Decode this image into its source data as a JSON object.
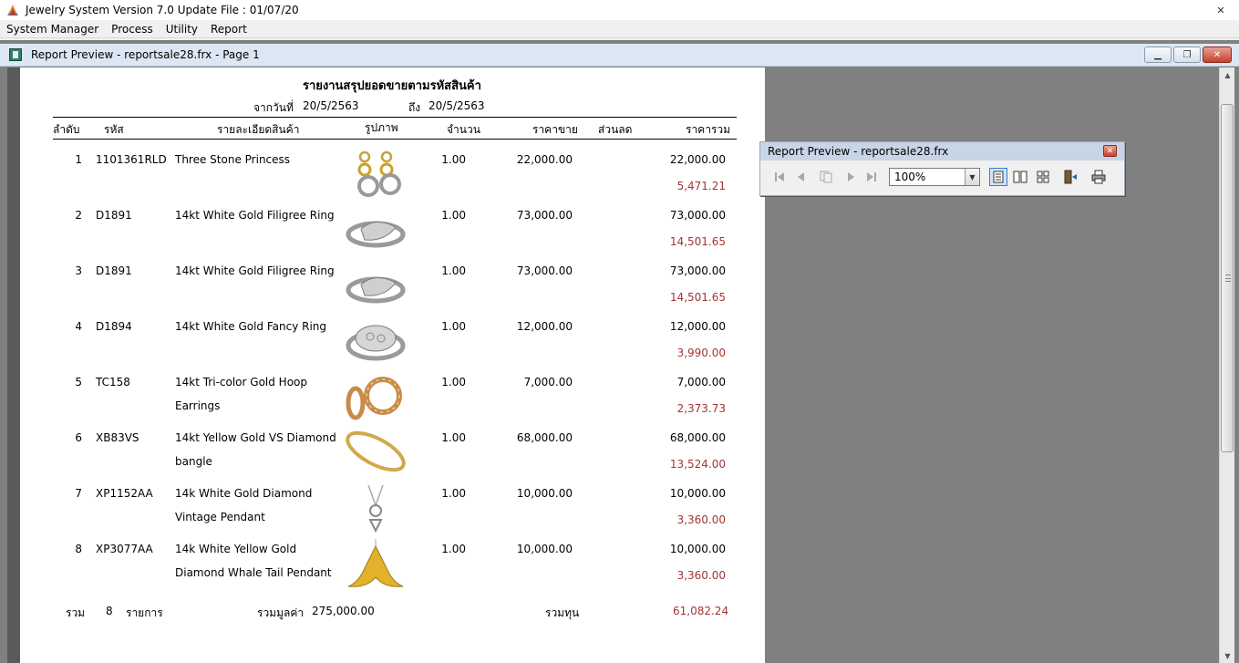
{
  "app": {
    "title": "Jewelry System Version 7.0 Update File : 01/07/20",
    "close_glyph": "✕"
  },
  "menu": [
    {
      "label": "System Manager"
    },
    {
      "label": "Process"
    },
    {
      "label": "Utility"
    },
    {
      "label": "Report"
    }
  ],
  "child_window": {
    "title": "Report Preview - reportsale28.frx - Page 1",
    "min_glyph": "▁",
    "restore_glyph": "❐",
    "close_glyph": "✕"
  },
  "report": {
    "title": "รายงานสรุปยอดขายตามรหัสสินค้า",
    "from_label": "จากวันที่",
    "from_date": "20/5/2563",
    "to_label": "ถึง",
    "to_date": "20/5/2563",
    "headers": {
      "no": "ลำดับ",
      "code": "รหัส",
      "detail": "รายละเอียดสินค้า",
      "image": "รูปภาพ",
      "qty": "จำนวน",
      "price": "ราคาขาย",
      "discount": "ส่วนลด",
      "total": "ราคารวม"
    },
    "rows": [
      {
        "no": "1",
        "code": "1101361RLD",
        "line1": "Three Stone Princess",
        "line2": "",
        "qty": "1.00",
        "price": "22,000.00",
        "total": "22,000.00",
        "cost": "5,471.21",
        "image": "earrings-icon"
      },
      {
        "no": "2",
        "code": "D1891",
        "line1": "14kt White Gold Filigree Ring",
        "line2": "",
        "qty": "1.00",
        "price": "73,000.00",
        "total": "73,000.00",
        "cost": "14,501.65",
        "image": "ring-icon"
      },
      {
        "no": "3",
        "code": "D1891",
        "line1": "14kt White Gold Filigree Ring",
        "line2": "",
        "qty": "1.00",
        "price": "73,000.00",
        "total": "73,000.00",
        "cost": "14,501.65",
        "image": "ring-icon"
      },
      {
        "no": "4",
        "code": "D1894",
        "line1": "14kt White Gold Fancy Ring",
        "line2": "",
        "qty": "1.00",
        "price": "12,000.00",
        "total": "12,000.00",
        "cost": "3,990.00",
        "image": "fancy-ring-icon"
      },
      {
        "no": "5",
        "code": "TC158",
        "line1": "14kt Tri-color Gold Hoop",
        "line2": "Earrings",
        "qty": "1.00",
        "price": "7,000.00",
        "total": "7,000.00",
        "cost": "2,373.73",
        "image": "hoop-earrings-icon"
      },
      {
        "no": "6",
        "code": "XB83VS",
        "line1": "14kt Yellow Gold VS Diamond",
        "line2": "bangle",
        "qty": "1.00",
        "price": "68,000.00",
        "total": "68,000.00",
        "cost": "13,524.00",
        "image": "bangle-icon"
      },
      {
        "no": "7",
        "code": "XP1152AA",
        "line1": "14k White Gold Diamond",
        "line2": "Vintage Pendant",
        "qty": "1.00",
        "price": "10,000.00",
        "total": "10,000.00",
        "cost": "3,360.00",
        "image": "pendant-icon"
      },
      {
        "no": "8",
        "code": "XP3077AA",
        "line1": "14k White Yellow Gold",
        "line2": "Diamond Whale Tail Pendant",
        "qty": "1.00",
        "price": "10,000.00",
        "total": "10,000.00",
        "cost": "3,360.00",
        "image": "whale-tail-pendant-icon"
      }
    ],
    "summary": {
      "label": "รวม",
      "count": "8",
      "items_label": "รายการ",
      "value_label": "รวมมูลค่า",
      "value": "275,000.00",
      "cost_label": "รวมทุน",
      "cost_total": "61,082.24"
    }
  },
  "toolbar": {
    "title": "Report Preview - reportsale28.frx",
    "close_glyph": "✕",
    "zoom": "100%",
    "icons": [
      "first-page-icon",
      "prev-page-icon",
      "goto-page-icon",
      "next-page-icon",
      "last-page-icon",
      "one-page-icon",
      "two-pages-icon",
      "four-pages-icon",
      "close-preview-icon",
      "print-icon"
    ]
  },
  "colors": {
    "cost_text": "#a33434",
    "workspace": "#808080",
    "title_bar": "#dde7f3"
  }
}
